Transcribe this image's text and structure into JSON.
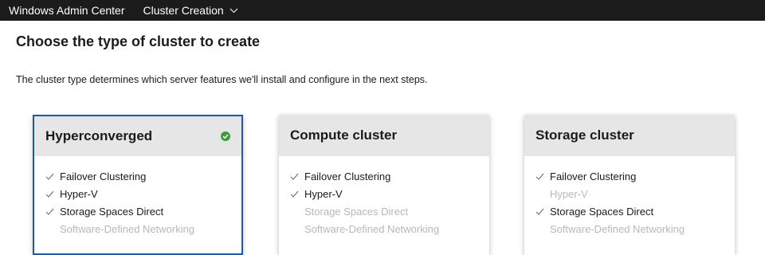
{
  "topbar": {
    "app_title": "Windows Admin Center",
    "nav_item": "Cluster Creation",
    "nav_icon": "chevron-down-icon"
  },
  "page": {
    "title": "Choose the type of cluster to create",
    "description": "The cluster type determines which server features we'll install and configure in the next steps."
  },
  "colors": {
    "selected_border": "#1f5aa6",
    "selected_check": "#3a9d3a",
    "header_bg": "#e6e6e6",
    "disabled_text": "#b8b8b8"
  },
  "cards": [
    {
      "title": "Hyperconverged",
      "selected": true,
      "features": [
        {
          "label": "Failover Clustering",
          "included": true
        },
        {
          "label": "Hyper-V",
          "included": true
        },
        {
          "label": "Storage Spaces Direct",
          "included": true
        },
        {
          "label": "Software-Defined Networking",
          "included": false
        }
      ]
    },
    {
      "title": "Compute cluster",
      "selected": false,
      "features": [
        {
          "label": "Failover Clustering",
          "included": true
        },
        {
          "label": "Hyper-V",
          "included": true
        },
        {
          "label": "Storage Spaces Direct",
          "included": false
        },
        {
          "label": "Software-Defined Networking",
          "included": false
        }
      ]
    },
    {
      "title": "Storage cluster",
      "selected": false,
      "features": [
        {
          "label": "Failover Clustering",
          "included": true
        },
        {
          "label": "Hyper-V",
          "included": false
        },
        {
          "label": "Storage Spaces Direct",
          "included": true
        },
        {
          "label": "Software-Defined Networking",
          "included": false
        }
      ]
    }
  ]
}
